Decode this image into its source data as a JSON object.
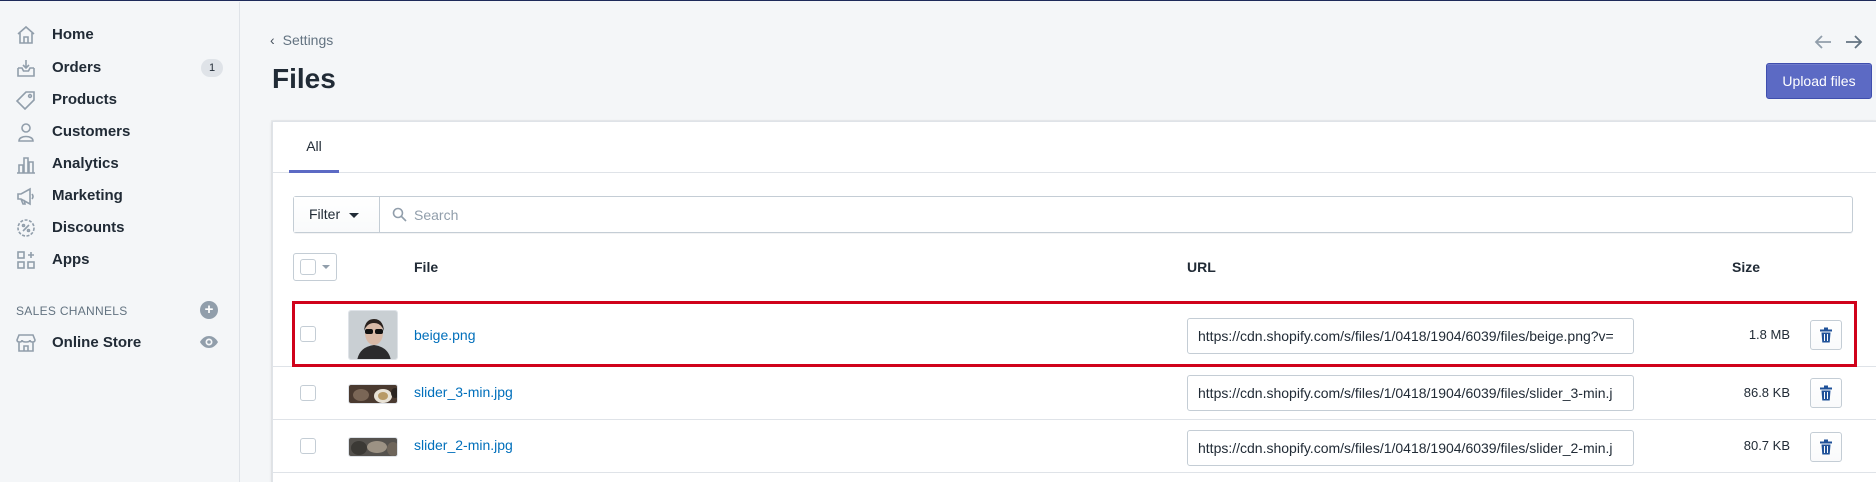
{
  "sidebar": {
    "items": [
      {
        "label": "Home",
        "icon": "home-icon"
      },
      {
        "label": "Orders",
        "icon": "orders-icon",
        "badge": "1"
      },
      {
        "label": "Products",
        "icon": "tag-icon"
      },
      {
        "label": "Customers",
        "icon": "person-icon"
      },
      {
        "label": "Analytics",
        "icon": "bar-chart-icon"
      },
      {
        "label": "Marketing",
        "icon": "megaphone-icon"
      },
      {
        "label": "Discounts",
        "icon": "discount-icon"
      },
      {
        "label": "Apps",
        "icon": "apps-icon"
      }
    ],
    "channels_heading": "SALES CHANNELS",
    "channels": [
      {
        "label": "Online Store",
        "icon": "store-icon"
      }
    ]
  },
  "header": {
    "breadcrumb": "Settings",
    "title": "Files",
    "upload_label": "Upload files"
  },
  "tabs": [
    {
      "label": "All",
      "active": true
    }
  ],
  "filter": {
    "button_label": "Filter",
    "search_placeholder": "Search"
  },
  "table": {
    "columns": {
      "file": "File",
      "url": "URL",
      "size": "Size"
    },
    "rows": [
      {
        "name": "beige.png",
        "url": "https://cdn.shopify.com/s/files/1/0418/1904/6039/files/beige.png?v=",
        "size": "1.8 MB",
        "highlighted": true
      },
      {
        "name": "slider_3-min.jpg",
        "url": "https://cdn.shopify.com/s/files/1/0418/1904/6039/files/slider_3-min.j",
        "size": "86.8 KB",
        "highlighted": false
      },
      {
        "name": "slider_2-min.jpg",
        "url": "https://cdn.shopify.com/s/files/1/0418/1904/6039/files/slider_2-min.j",
        "size": "80.7 KB",
        "highlighted": false
      }
    ]
  },
  "colors": {
    "accent": "#5c6ac4",
    "link": "#006fbb",
    "highlight": "#d0021b"
  }
}
